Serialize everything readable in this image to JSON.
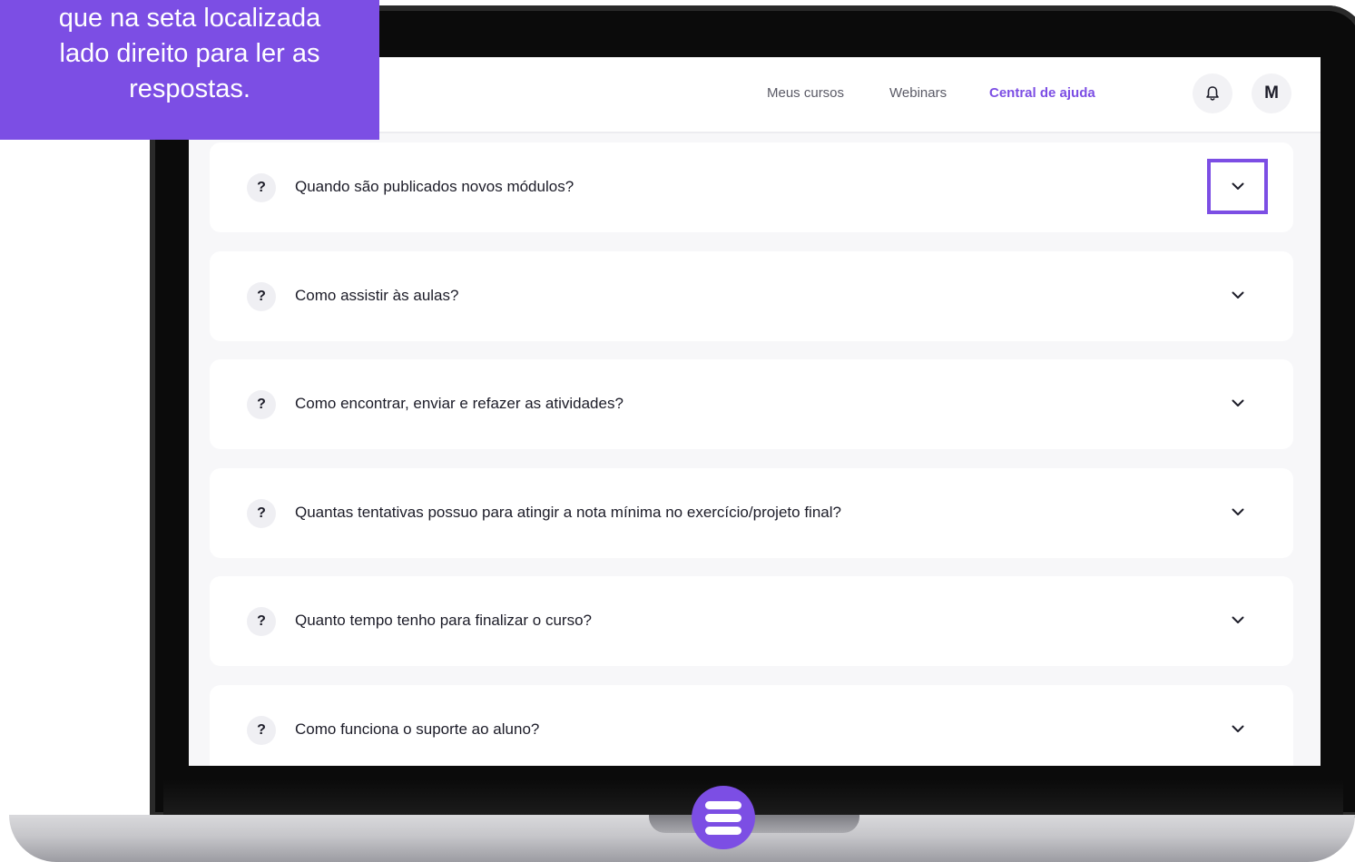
{
  "callout": {
    "lines": [
      "que na seta localizada",
      "lado direito para ler as",
      "respostas."
    ]
  },
  "navbar": {
    "links": [
      {
        "label": "Meus cursos",
        "active": false
      },
      {
        "label": "Webinars",
        "active": false
      },
      {
        "label": "Central de ajuda",
        "active": true
      }
    ],
    "avatar_initial": "M",
    "bell_icon": "bell-icon"
  },
  "faq": {
    "badge": "?",
    "items": [
      {
        "question": "Quando são publicados novos módulos?"
      },
      {
        "question": "Como assistir às aulas?"
      },
      {
        "question": "Como encontrar, enviar e refazer as atividades?"
      },
      {
        "question": "Quantas tentativas possuo para atingir a nota mínima no exercício/projeto final?"
      },
      {
        "question": "Quanto tempo tenho para finalizar o curso?"
      },
      {
        "question": "Como funciona o suporte ao aluno?"
      }
    ],
    "chevron_icon": "chevron-down-icon"
  },
  "colors": {
    "accent": "#7c4ee4",
    "screen_bg": "#f7f7f9",
    "card_bg": "#ffffff",
    "text": "#1c1c28"
  }
}
